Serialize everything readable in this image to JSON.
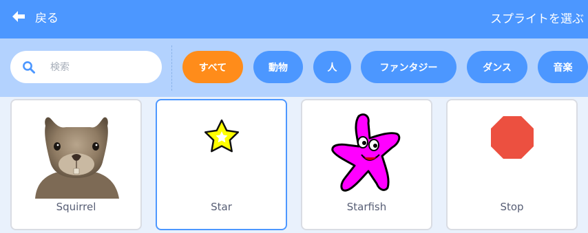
{
  "header": {
    "back_label": "戻る",
    "title": "スプライトを選ぶ",
    "back_icon": "arrow-left-icon"
  },
  "search": {
    "placeholder": "検索",
    "value": "",
    "icon": "search-icon"
  },
  "tags": [
    {
      "label": "すべて",
      "active": true
    },
    {
      "label": "動物",
      "active": false
    },
    {
      "label": "人",
      "active": false
    },
    {
      "label": "ファンタジー",
      "active": false
    },
    {
      "label": "ダンス",
      "active": false
    },
    {
      "label": "音楽",
      "active": false
    }
  ],
  "sprites": [
    {
      "name": "Squirrel",
      "icon": "squirrel-photo"
    },
    {
      "name": "Star",
      "icon": "star-icon",
      "selected": true
    },
    {
      "name": "Starfish",
      "icon": "starfish-icon"
    },
    {
      "name": "Stop",
      "icon": "stop-octagon-icon"
    }
  ],
  "colors": {
    "header": "#4c97ff",
    "filter_bar": "#b3d2fe",
    "tag": "#4c97ff",
    "tag_active": "#ff8c1a",
    "card_border": "#d9dce3",
    "card_selected_border": "#4c97ff",
    "label_text": "#575e75"
  }
}
